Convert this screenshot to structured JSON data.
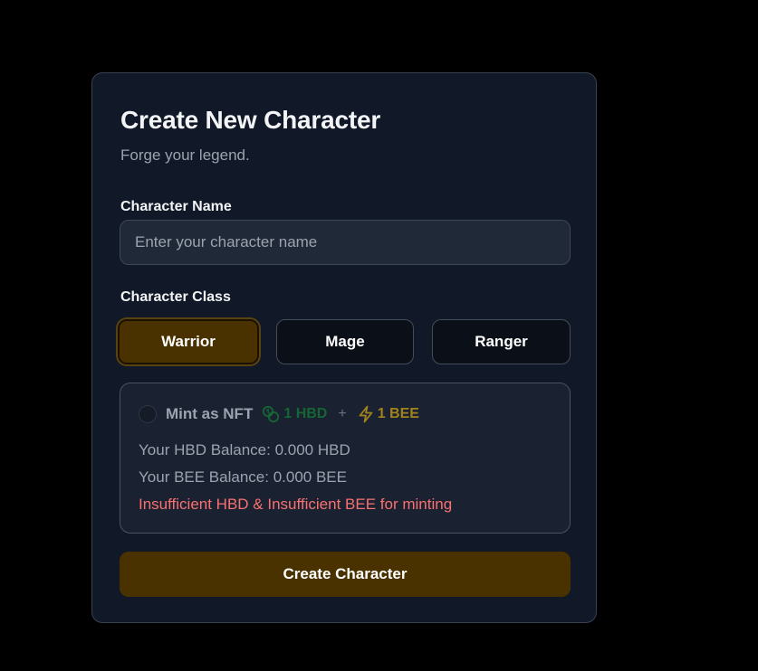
{
  "form": {
    "title": "Create New Character",
    "subtitle": "Forge your legend."
  },
  "name_field": {
    "label": "Character Name",
    "placeholder": "Enter your character name",
    "value": ""
  },
  "class_field": {
    "label": "Character Class",
    "options": [
      {
        "label": "Warrior",
        "selected": true
      },
      {
        "label": "Mage",
        "selected": false
      },
      {
        "label": "Ranger",
        "selected": false
      }
    ]
  },
  "nft": {
    "checked": false,
    "label": "Mint as NFT",
    "hbd_cost": "1 HBD",
    "plus": "+",
    "bee_cost": "1 BEE",
    "hbd_balance": "Your HBD Balance: 0.000 HBD",
    "bee_balance": "Your BEE Balance: 0.000 BEE",
    "warning": "Insufficient HBD & Insufficient BEE for minting",
    "icons": {
      "hbd": "coins-icon",
      "bee": "lightning-bolt-icon"
    }
  },
  "submit_label": "Create Character",
  "colors": {
    "page_background": "#000000",
    "card_background": "#111827",
    "accent": "#4a3200",
    "hbd": "#166534",
    "bee": "#a1831c",
    "warning": "#f87171"
  }
}
